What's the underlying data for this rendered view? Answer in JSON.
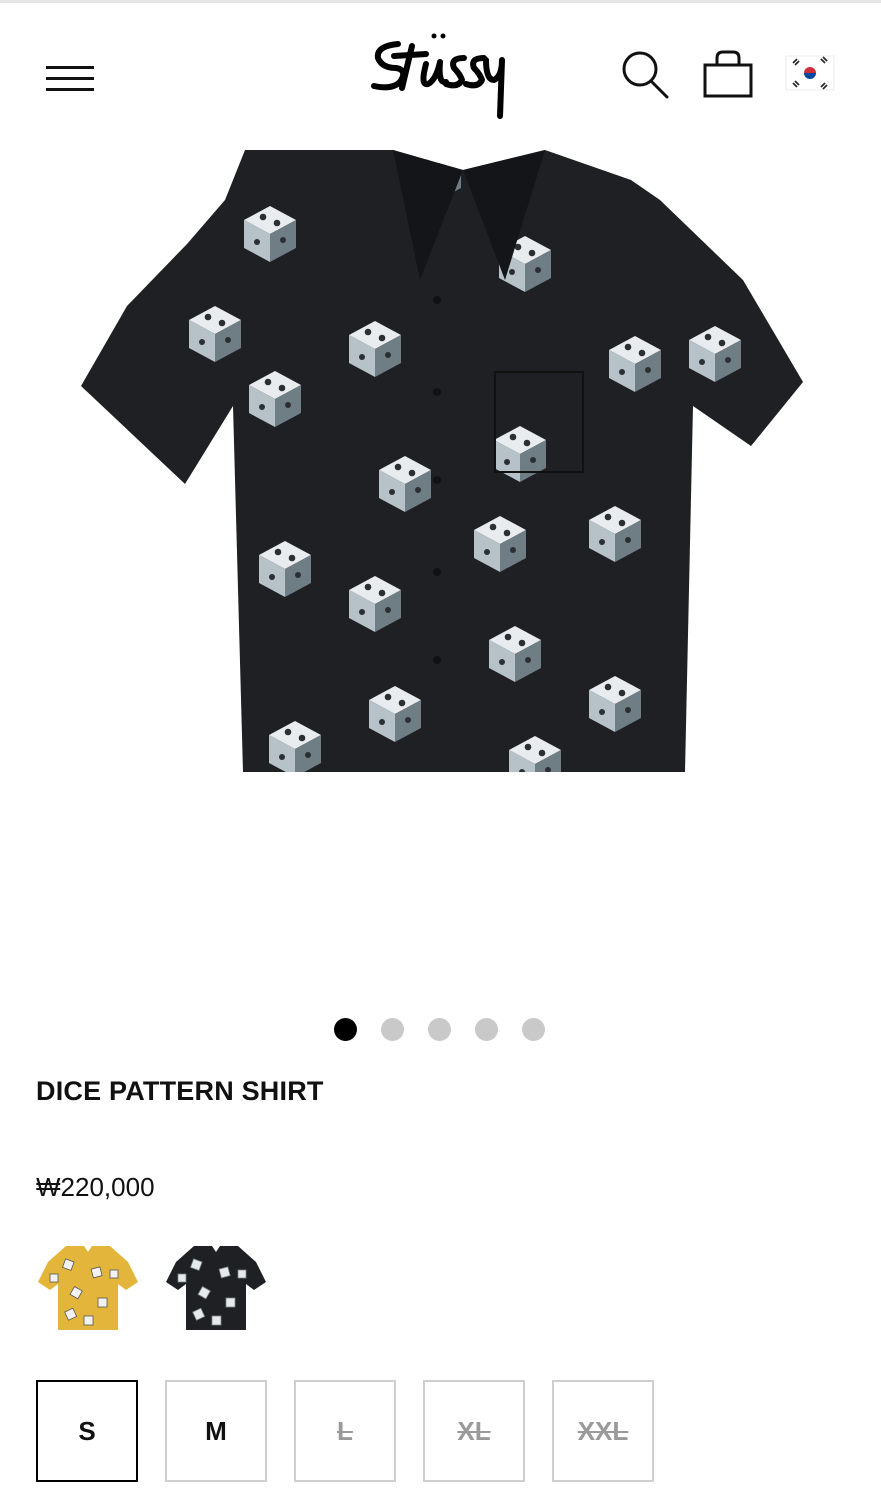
{
  "header": {
    "menu_icon": "hamburger-menu-icon",
    "logo_icon": "stussy-logo",
    "search_icon": "search-icon",
    "cart_icon": "shopping-bag-icon",
    "flag_icon": "korea-flag-icon"
  },
  "gallery": {
    "dot_count": 5,
    "active_index": 0
  },
  "product": {
    "title": "DICE PATTERN SHIRT",
    "price": "₩220,000",
    "colors": [
      {
        "name": "Yellow",
        "hex": "#e3b53a",
        "selected": false
      },
      {
        "name": "Black",
        "hex": "#1f2023",
        "selected": true
      }
    ],
    "sizes": [
      {
        "label": "S",
        "selected": true,
        "available": true
      },
      {
        "label": "M",
        "selected": false,
        "available": true
      },
      {
        "label": "L",
        "selected": false,
        "available": false
      },
      {
        "label": "XL",
        "selected": false,
        "available": false
      },
      {
        "label": "XXL",
        "selected": false,
        "available": false
      }
    ]
  }
}
